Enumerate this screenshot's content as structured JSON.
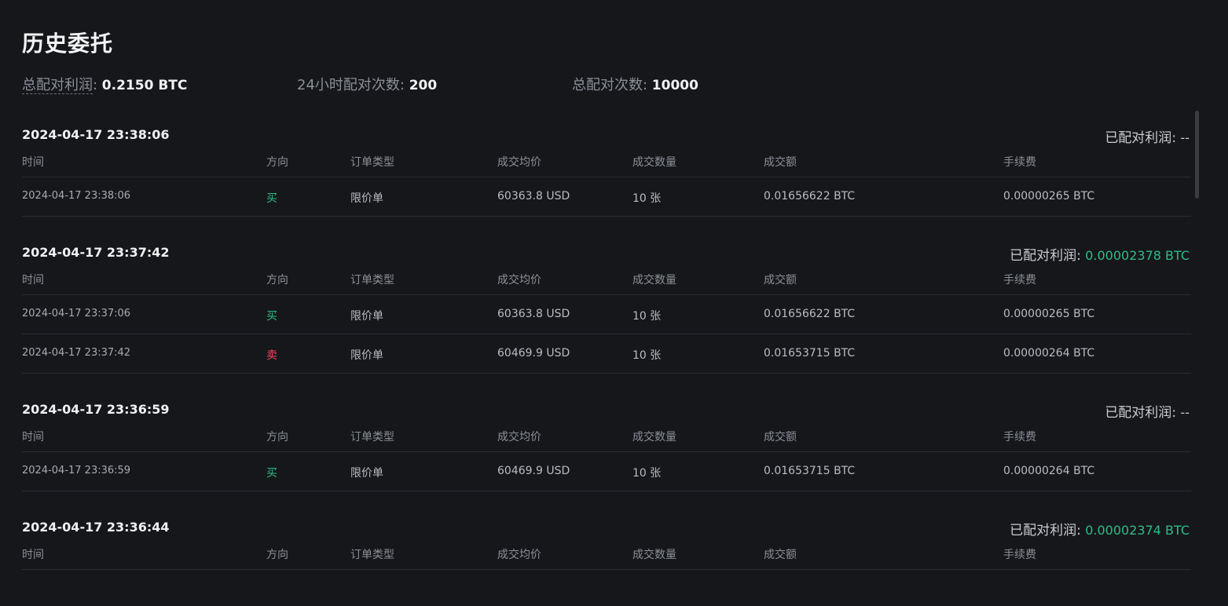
{
  "page": {
    "title": "历史委托"
  },
  "stats": [
    {
      "label": "总配对利润",
      "value": "0.2150 BTC"
    },
    {
      "label": "24小时配对次数",
      "value": "200"
    },
    {
      "label": "总配对次数",
      "value": "10000"
    }
  ],
  "columns": [
    "时间",
    "方向",
    "订单类型",
    "成交均价",
    "成交数量",
    "成交额",
    "手续费"
  ],
  "profit_label": "已配对利润",
  "groups": [
    {
      "time": "2024-04-17 23:38:06",
      "profit": "--",
      "rows": [
        {
          "time": "2024-04-17 23:38:06",
          "side": "买",
          "type": "限价单",
          "price": "60363.8 USD",
          "qty": "10 张",
          "amount": "0.01656622 BTC",
          "fee": "0.00000265 BTC"
        }
      ]
    },
    {
      "time": "2024-04-17 23:37:42",
      "profit": "0.00002378 BTC",
      "rows": [
        {
          "time": "2024-04-17 23:37:06",
          "side": "买",
          "type": "限价单",
          "price": "60363.8 USD",
          "qty": "10 张",
          "amount": "0.01656622 BTC",
          "fee": "0.00000265 BTC"
        },
        {
          "time": "2024-04-17 23:37:42",
          "side": "卖",
          "type": "限价单",
          "price": "60469.9 USD",
          "qty": "10 张",
          "amount": "0.01653715 BTC",
          "fee": "0.00000264 BTC"
        }
      ]
    },
    {
      "time": "2024-04-17 23:36:59",
      "profit": "--",
      "rows": [
        {
          "time": "2024-04-17 23:36:59",
          "side": "买",
          "type": "限价单",
          "price": "60469.9 USD",
          "qty": "10 张",
          "amount": "0.01653715 BTC",
          "fee": "0.00000264 BTC"
        }
      ]
    },
    {
      "time": "2024-04-17 23:36:44",
      "profit": "0.00002374 BTC",
      "rows": []
    }
  ],
  "colors": {
    "buy": "#2ebd85",
    "sell": "#f6465d",
    "positive_profit": "#2ebd85",
    "background": "#16171b"
  }
}
